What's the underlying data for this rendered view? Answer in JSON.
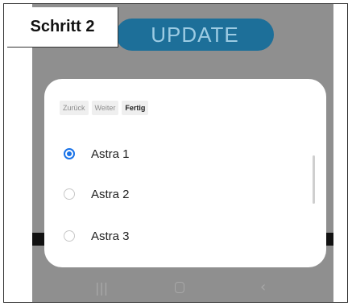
{
  "step_label": "Schritt 2",
  "update_button": "UPDATE",
  "dialog": {
    "tabs": [
      {
        "label": "Zurück",
        "active": false
      },
      {
        "label": "Weiter",
        "active": false
      },
      {
        "label": "Fertig",
        "active": true
      }
    ],
    "options": [
      {
        "label": "Astra 1",
        "selected": true
      },
      {
        "label": "Astra 2",
        "selected": false
      },
      {
        "label": "Astra 3",
        "selected": false
      }
    ]
  },
  "navbar": {
    "recent_icon": "recent-apps-icon",
    "home_icon": "home-icon",
    "back_icon": "back-icon"
  },
  "colors": {
    "accent": "#1a73e8",
    "update_button_bg": "#1d6f99",
    "overlay": "#8f8f8f"
  }
}
